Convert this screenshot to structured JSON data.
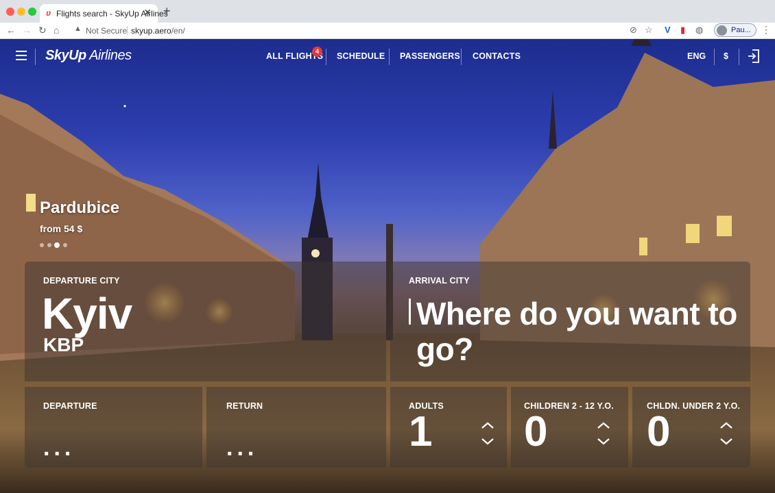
{
  "browser": {
    "tab_title": "Flights search - SkyUp Airlines",
    "tab_favicon": "ʋ",
    "close_glyph": "✕",
    "new_tab_glyph": "+",
    "security_label": "Not Secure",
    "url_host": "skyup.aero",
    "url_path": "/en/",
    "profile_name": "Pau..."
  },
  "header": {
    "logo_bold": "SkyUp",
    "logo_light": " Airlines",
    "nav": [
      {
        "label": "ALL FLIGHTS"
      },
      {
        "label": "SCHEDULE"
      },
      {
        "label": "PASSENGERS"
      },
      {
        "label": "CONTACTS"
      }
    ],
    "all_flights_badge": "4",
    "language": "ENG",
    "currency": "$"
  },
  "promo": {
    "city": "Pardubice",
    "price": "from 54 $",
    "slide_count": 4,
    "active_slide": 3
  },
  "search": {
    "departure_label": "DEPARTURE CITY",
    "departure_city": "Kyiv",
    "departure_code": "KBP",
    "arrival_label": "ARRIVAL CITY",
    "arrival_placeholder": "Where do you want to go?",
    "departure_date_label": "DEPARTURE",
    "departure_date_value": "...",
    "return_date_label": "RETURN",
    "return_date_value": "...",
    "adults_label": "ADULTS",
    "adults_count": "1",
    "children_label": "CHILDREN 2 - 12 Y.O.",
    "children_count": "0",
    "infants_label": "CHLDN. UNDER 2 Y.O.",
    "infants_count": "0"
  },
  "colors": {
    "badge": "#e53935",
    "sky_top": "#1c2c8e",
    "panel_overlay": "rgba(60,52,48,0.48)"
  },
  "icons": [
    "back-arrow-icon",
    "forward-arrow-icon",
    "reload-icon",
    "home-icon",
    "warning-icon",
    "eye-off-icon",
    "star-icon",
    "menu-icon",
    "login-icon",
    "chevron-up-icon",
    "chevron-down-icon"
  ]
}
